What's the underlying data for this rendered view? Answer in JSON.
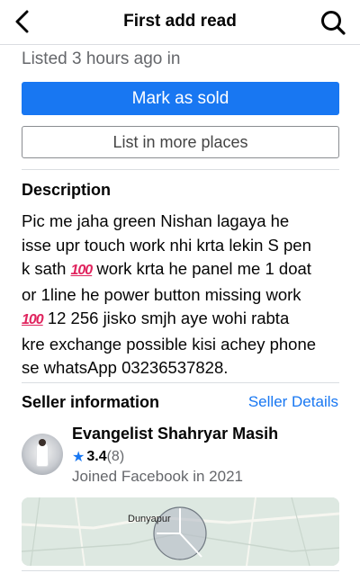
{
  "header": {
    "title": "First add read",
    "back_icon": "chevron-left-icon",
    "search_icon": "search-icon"
  },
  "listing": {
    "listed_text": "Listed 3 hours ago in"
  },
  "actions": {
    "mark_sold_label": "Mark as sold",
    "list_more_label": "List in more places"
  },
  "description": {
    "title": "Description",
    "line1": "Pic me jaha green Nishan lagaya he",
    "line2": "isse upr touch work nhi krta lekin S pen",
    "line3_a": "k sath ",
    "line3_emoji": "100",
    "line3_b": " work krta he panel me 1 doat",
    "line4": "or 1line he power button missing work",
    "line5_emoji": "100",
    "line5_b": " 12 256  jisko smjh aye wohi rabta",
    "line6": "kre exchange possible kisi achey phone",
    "line7": "se whatsApp 03236537828."
  },
  "seller": {
    "title": "Seller information",
    "details_link": "Seller Details",
    "name": "Evangelist Shahryar Masih",
    "rating": "3.4",
    "rating_count": "(8)",
    "joined": "Joined Facebook in 2021"
  },
  "map": {
    "place_label": "Dunyapur"
  },
  "colors": {
    "accent": "#1877f2",
    "secondary_text": "#65676b"
  }
}
